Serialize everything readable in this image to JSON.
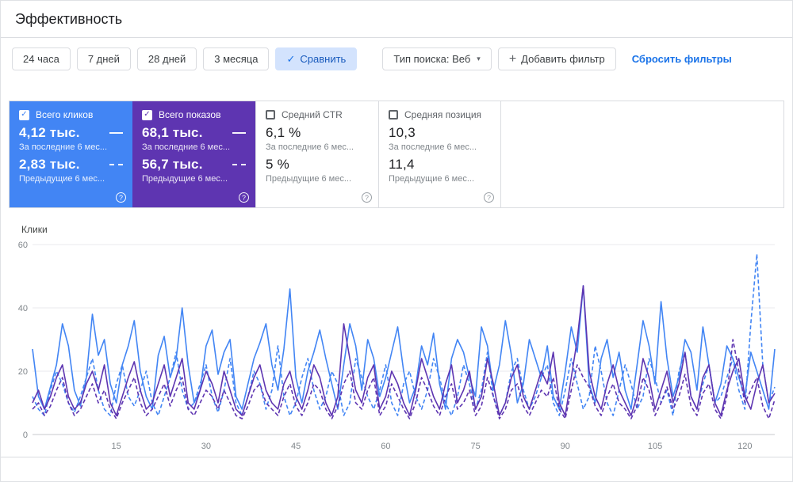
{
  "page": {
    "title": "Эффективность"
  },
  "icons": {
    "check": "✓",
    "caret_down": "▾",
    "plus": "+",
    "help": "?"
  },
  "colors": {
    "clicks_blue": "#4285f4",
    "impressions_purple": "#5e35b1",
    "link_blue": "#1a73e8",
    "compare_chip_bg": "#d3e3fd"
  },
  "toolbar": {
    "date_buttons": [
      "24 часа",
      "7 дней",
      "28 дней",
      "3 месяца"
    ],
    "compare_button": "Сравнить",
    "search_type": "Тип поиска: Веб",
    "add_filter": "Добавить фильтр",
    "reset_filters": "Сбросить фильтры"
  },
  "cards": [
    {
      "label": "Всего кликов",
      "checked": true,
      "value1": "4,12 тыс.",
      "sub1": "За последние 6 мес...",
      "value2": "2,83 тыс.",
      "sub2": "Предыдущие 6 мес..."
    },
    {
      "label": "Всего показов",
      "checked": true,
      "value1": "68,1 тыс.",
      "sub1": "За последние 6 мес...",
      "value2": "56,7 тыс.",
      "sub2": "Предыдущие 6 мес..."
    },
    {
      "label": "Средний CTR",
      "checked": false,
      "value1": "6,1 %",
      "sub1": "За последние 6 мес...",
      "value2": "5 %",
      "sub2": "Предыдущие 6 мес..."
    },
    {
      "label": "Средняя позиция",
      "checked": false,
      "value1": "10,3",
      "sub1": "За последние 6 мес...",
      "value2": "11,4",
      "sub2": "Предыдущие 6 мес..."
    }
  ],
  "chart_data": {
    "type": "line",
    "ylabel": "Клики",
    "ylim": [
      0,
      60
    ],
    "yticks": [
      0,
      20,
      40,
      60
    ],
    "xticks": [
      15,
      30,
      45,
      60,
      75,
      90,
      105,
      120
    ],
    "x_range": [
      1,
      125
    ],
    "grid": true,
    "series": [
      {
        "name": "Всего кликов — за последние 6 мес.",
        "color": "#4285f4",
        "dash": false,
        "values": [
          27,
          12,
          8,
          15,
          22,
          35,
          28,
          14,
          9,
          18,
          38,
          25,
          30,
          16,
          10,
          22,
          28,
          36,
          20,
          12,
          8,
          25,
          31,
          18,
          24,
          40,
          22,
          10,
          14,
          28,
          33,
          19,
          26,
          30,
          12,
          8,
          16,
          24,
          29,
          35,
          22,
          14,
          27,
          46,
          18,
          10,
          20,
          26,
          33,
          24,
          16,
          8,
          22,
          35,
          28,
          14,
          30,
          24,
          12,
          18,
          26,
          34,
          20,
          10,
          15,
          28,
          22,
          32,
          16,
          8,
          24,
          30,
          26,
          18,
          12,
          34,
          28,
          14,
          22,
          36,
          25,
          10,
          16,
          30,
          24,
          18,
          28,
          12,
          8,
          20,
          34,
          26,
          47,
          16,
          10,
          24,
          30,
          18,
          26,
          14,
          8,
          22,
          36,
          28,
          16,
          42,
          24,
          12,
          18,
          30,
          26,
          14,
          34,
          22,
          10,
          16,
          28,
          24,
          18,
          12,
          26,
          20,
          14,
          8,
          27
        ]
      },
      {
        "name": "Всего кликов — предыдущие 6 мес.",
        "color": "#4285f4",
        "dash": true,
        "values": [
          12,
          8,
          6,
          14,
          20,
          16,
          10,
          7,
          12,
          18,
          24,
          14,
          8,
          6,
          16,
          22,
          12,
          9,
          14,
          20,
          10,
          6,
          12,
          18,
          26,
          14,
          8,
          10,
          16,
          22,
          12,
          7,
          14,
          24,
          10,
          6,
          12,
          20,
          16,
          8,
          14,
          28,
          12,
          6,
          10,
          18,
          24,
          14,
          8,
          12,
          20,
          16,
          6,
          10,
          24,
          18,
          12,
          8,
          14,
          22,
          10,
          6,
          16,
          20,
          12,
          8,
          14,
          24,
          18,
          10,
          6,
          12,
          22,
          16,
          8,
          14,
          26,
          12,
          6,
          10,
          20,
          24,
          14,
          8,
          12,
          18,
          22,
          10,
          6,
          14,
          24,
          16,
          8,
          12,
          28,
          20,
          10,
          6,
          14,
          22,
          16,
          8,
          12,
          24,
          18,
          10,
          14,
          6,
          20,
          26,
          12,
          8,
          16,
          22,
          10,
          12,
          18,
          24,
          14,
          8,
          35,
          57,
          22,
          10,
          15
        ]
      },
      {
        "name": "Всего показов — за последние 6 мес.",
        "color": "#5e35b1",
        "dash": false,
        "values": [
          10,
          14,
          8,
          12,
          18,
          22,
          12,
          8,
          10,
          16,
          20,
          14,
          22,
          10,
          6,
          12,
          18,
          23,
          14,
          8,
          10,
          16,
          22,
          12,
          18,
          24,
          10,
          8,
          14,
          20,
          16,
          10,
          20,
          14,
          8,
          6,
          12,
          18,
          22,
          14,
          10,
          8,
          16,
          20,
          12,
          8,
          14,
          22,
          18,
          10,
          6,
          12,
          35,
          24,
          14,
          10,
          18,
          22,
          8,
          12,
          20,
          16,
          10,
          6,
          14,
          24,
          18,
          12,
          8,
          16,
          22,
          10,
          14,
          20,
          8,
          12,
          24,
          16,
          6,
          10,
          18,
          22,
          12,
          8,
          14,
          20,
          16,
          26,
          10,
          6,
          18,
          30,
          47,
          20,
          12,
          8,
          16,
          22,
          14,
          10,
          6,
          12,
          24,
          18,
          8,
          14,
          20,
          10,
          16,
          26,
          12,
          8,
          18,
          22,
          10,
          6,
          14,
          20,
          24,
          12,
          8,
          16,
          22,
          10,
          13
        ]
      },
      {
        "name": "Всего показов — предыдущие 6 мес.",
        "color": "#5e35b1",
        "dash": true,
        "values": [
          8,
          10,
          6,
          9,
          14,
          18,
          10,
          6,
          8,
          12,
          16,
          10,
          14,
          8,
          5,
          10,
          14,
          18,
          10,
          6,
          8,
          12,
          16,
          9,
          14,
          18,
          8,
          6,
          10,
          14,
          12,
          8,
          14,
          10,
          6,
          5,
          9,
          14,
          16,
          10,
          8,
          6,
          12,
          16,
          9,
          6,
          10,
          16,
          14,
          8,
          5,
          9,
          16,
          20,
          10,
          8,
          14,
          18,
          6,
          9,
          16,
          12,
          8,
          5,
          10,
          18,
          14,
          9,
          6,
          12,
          16,
          8,
          10,
          14,
          6,
          9,
          18,
          12,
          5,
          8,
          14,
          16,
          9,
          6,
          10,
          14,
          12,
          18,
          8,
          5,
          14,
          22,
          18,
          15,
          9,
          6,
          12,
          16,
          10,
          8,
          5,
          9,
          18,
          14,
          6,
          10,
          15,
          8,
          12,
          19,
          9,
          6,
          13,
          16,
          8,
          5,
          12,
          30,
          20,
          10,
          14,
          18,
          9,
          5,
          11
        ]
      }
    ]
  }
}
